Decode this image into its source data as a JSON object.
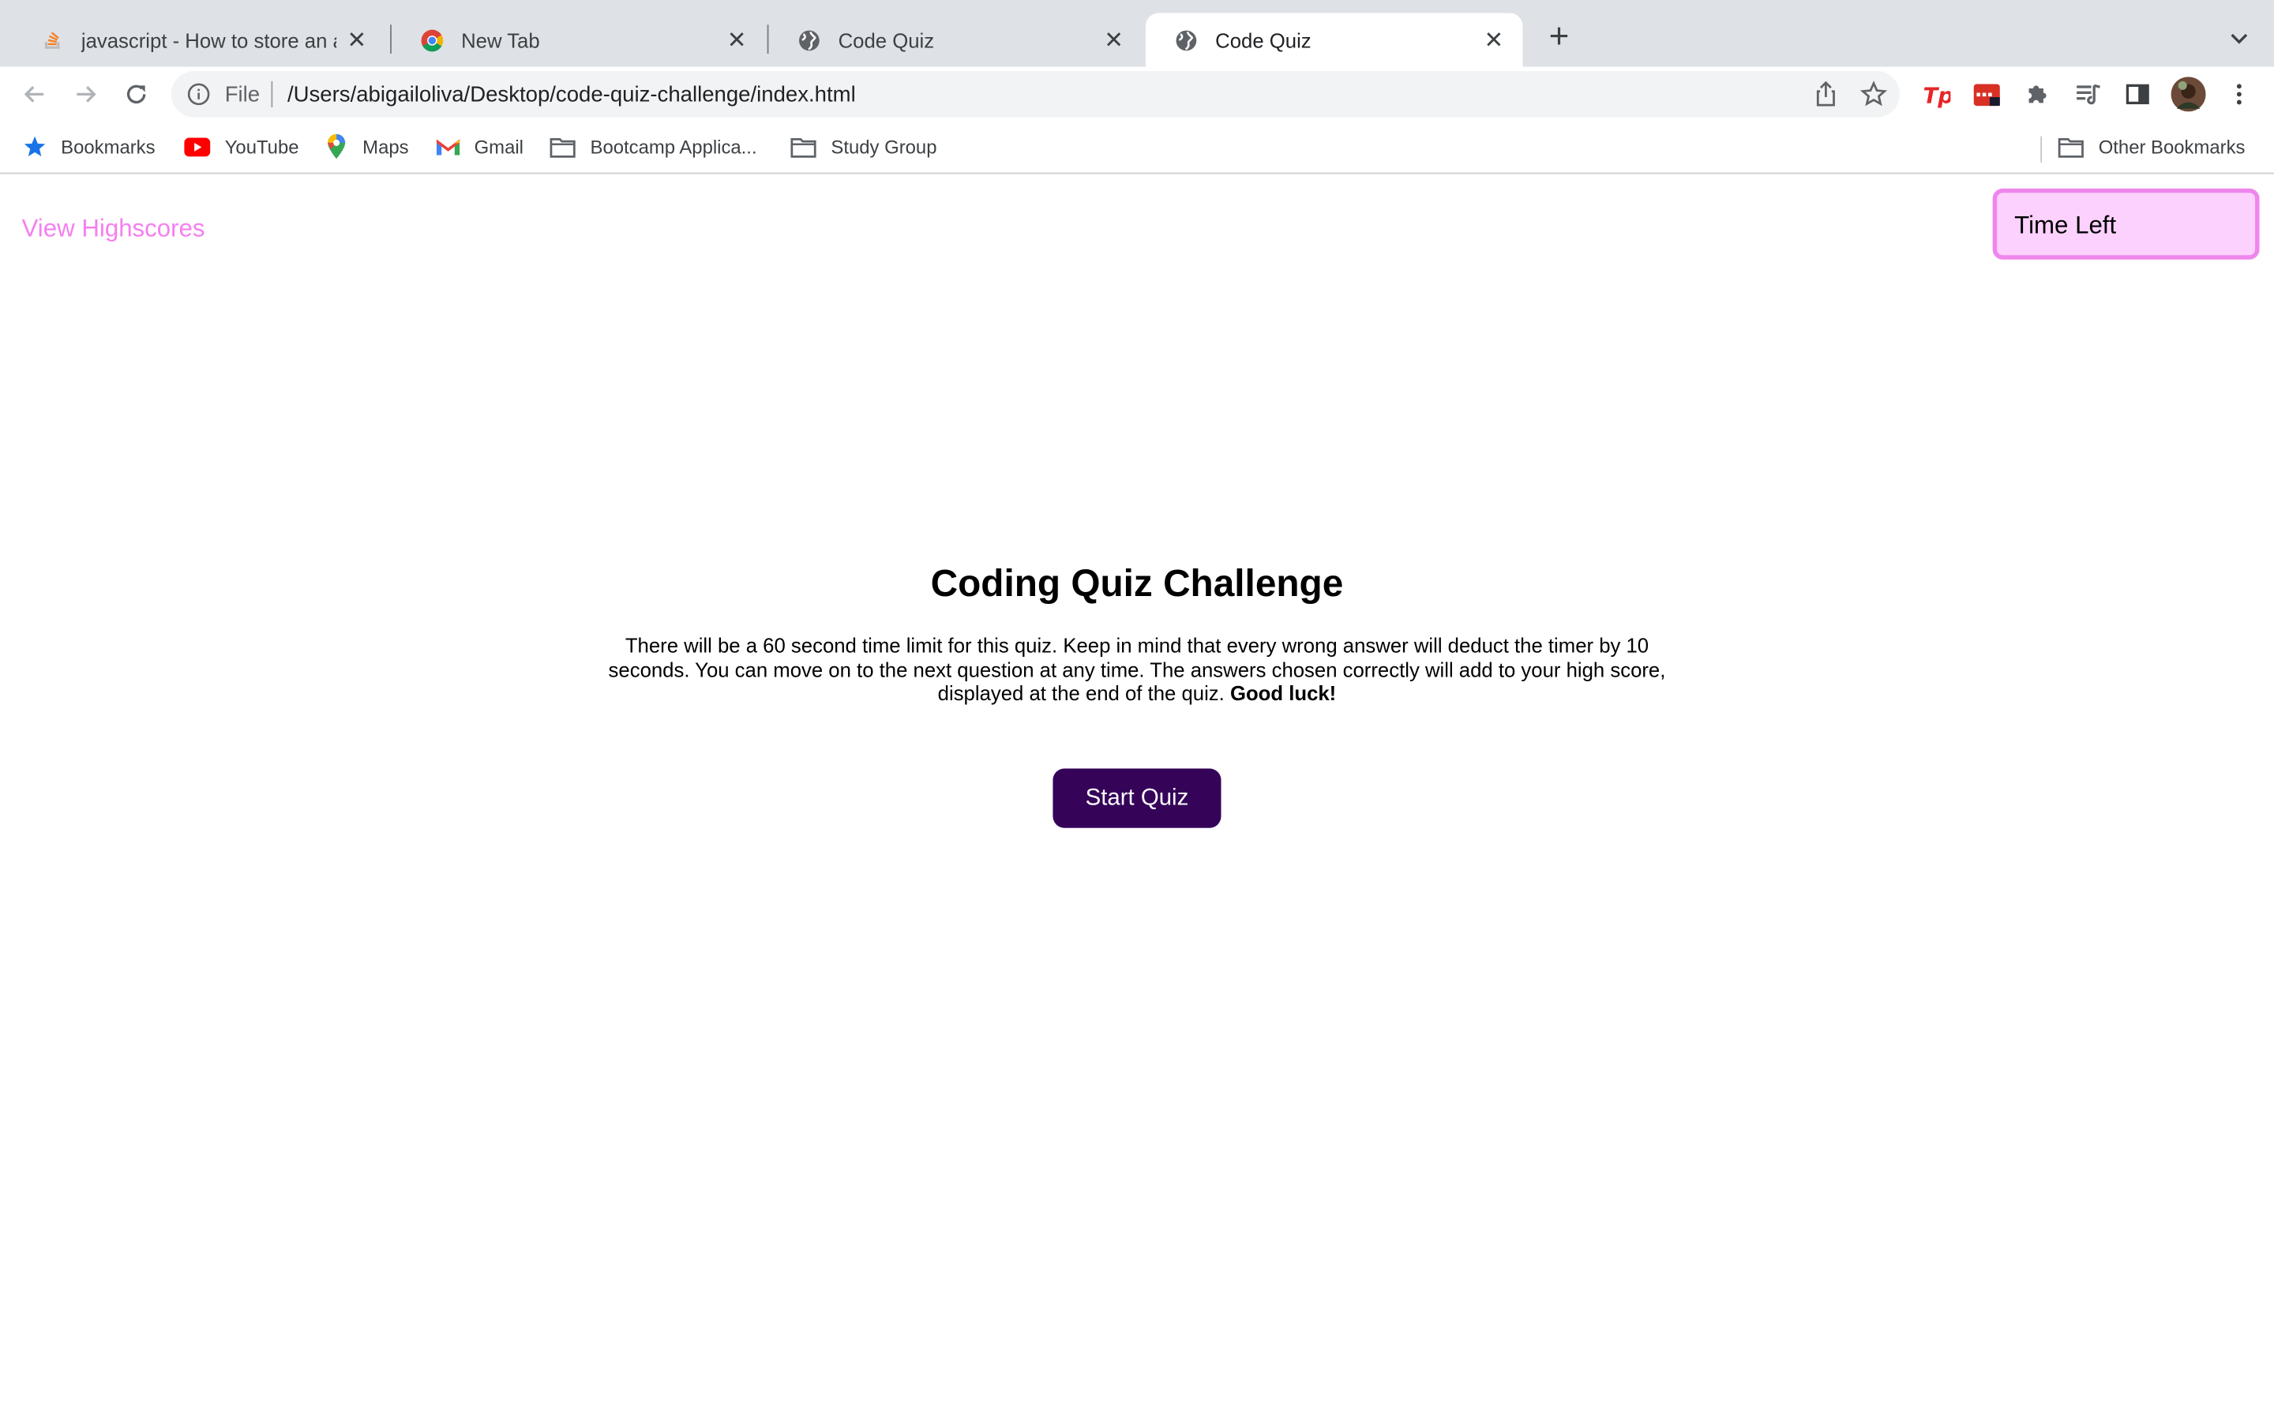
{
  "browser": {
    "tabs": [
      {
        "title": "javascript - How to store an arr",
        "favicon": "stackoverflow-icon",
        "active": false
      },
      {
        "title": "New Tab",
        "favicon": "chrome-icon",
        "active": false
      },
      {
        "title": "Code Quiz",
        "favicon": "globe-icon",
        "active": false
      },
      {
        "title": "Code Quiz",
        "favicon": "globe-icon",
        "active": true
      }
    ],
    "address": {
      "scheme_label": "File",
      "url": "/Users/abigailoliva/Desktop/code-quiz-challenge/index.html"
    },
    "bookmarks": [
      {
        "label": "Bookmarks",
        "icon": "star-icon"
      },
      {
        "label": "YouTube",
        "icon": "youtube-icon"
      },
      {
        "label": "Maps",
        "icon": "maps-icon"
      },
      {
        "label": "Gmail",
        "icon": "gmail-icon"
      },
      {
        "label": "Bootcamp Applica...",
        "icon": "folder-icon"
      },
      {
        "label": "Study Group",
        "icon": "folder-icon"
      }
    ],
    "other_bookmarks": "Other Bookmarks"
  },
  "page": {
    "highscores_link": "View Highscores",
    "timer_label": "Time Left",
    "title": "Coding Quiz Challenge",
    "description": "There will be a 60 second time limit for this quiz. Keep in mind that every wrong answer will deduct the timer by 10 seconds. You can move on to the next question at any time. The answers chosen correctly will add to your high score, displayed at the end of the quiz.",
    "description_bold": "Good luck!",
    "start_button": "Start Quiz"
  },
  "colors": {
    "highscores": "#f57ff0",
    "timer_bg": "#fdd1fd",
    "timer_border": "#ef86ed",
    "start_button_bg": "#350459"
  }
}
